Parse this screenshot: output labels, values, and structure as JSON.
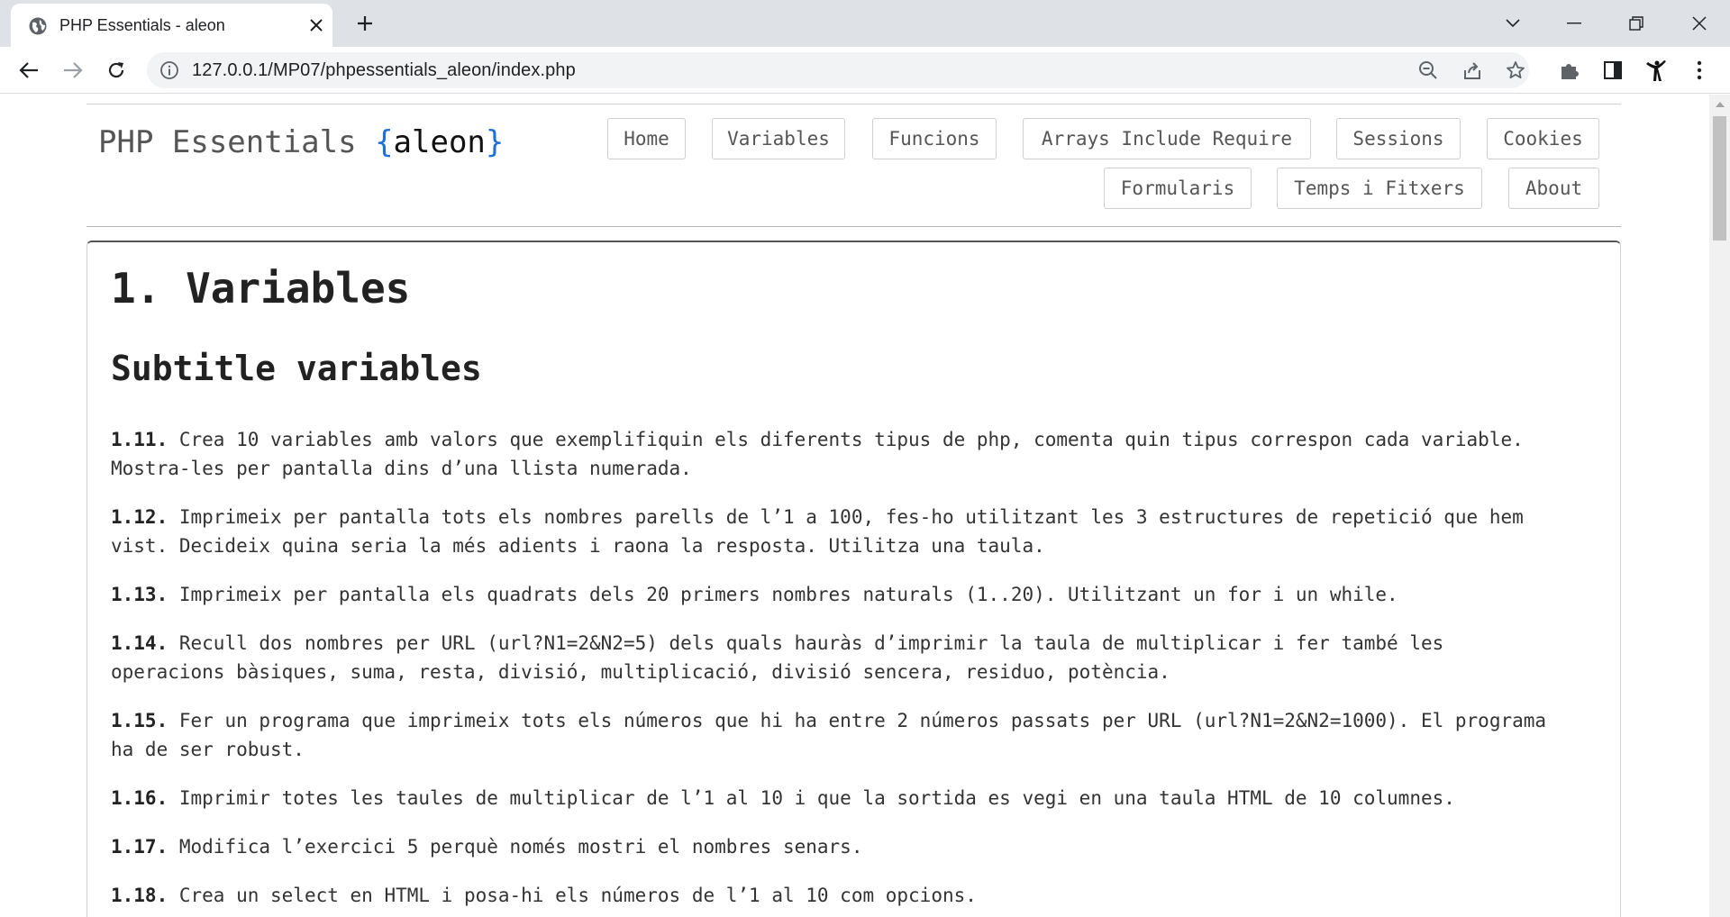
{
  "browser": {
    "tab_title": "PHP Essentials - aleon",
    "url": "127.0.0.1/MP07/phpessentials_aleon/index.php",
    "icons": [
      "globe-icon",
      "close-icon",
      "plus-icon",
      "chevron-down-icon",
      "minimize-icon",
      "restore-icon",
      "window-close-icon",
      "back-arrow-icon",
      "forward-arrow-icon",
      "reload-icon",
      "info-icon",
      "zoom-out-icon",
      "share-icon",
      "star-icon",
      "puzzle-icon",
      "side-panel-icon",
      "profile-icon",
      "kebab-menu-icon"
    ]
  },
  "site": {
    "brand_prefix": "PHP Essentials",
    "brace_open": "{",
    "brand_name": "aleon",
    "brace_close": "}",
    "nav": {
      "home": "Home",
      "variables": "Variables",
      "funcions": "Funcions",
      "arrays": "Arrays Include Require",
      "sessions": "Sessions",
      "cookies": "Cookies",
      "formularis": "Formularis",
      "temps": "Temps i Fitxers",
      "about": "About"
    }
  },
  "content": {
    "title": "1. Variables",
    "subtitle": "Subtitle variables",
    "exercises": [
      {
        "num": "1.11.",
        "text": "Crea 10 variables amb valors que exemplifiquin els diferents tipus de php, comenta quin tipus correspon cada variable.",
        "text2": "Mostra-les per pantalla dins d’una llista numerada."
      },
      {
        "num": "1.12.",
        "text": "Imprimeix per pantalla tots els nombres parells de l’1 a 100, fes-ho utilitzant les 3 estructures de repetició que hem",
        "text2": "vist. Decideix quina seria la més adients i raona la resposta. Utilitza una taula."
      },
      {
        "num": "1.13.",
        "text": "Imprimeix per pantalla els quadrats dels 20 primers nombres naturals (1..20). Utilitzant un for i un while.",
        "text2": ""
      },
      {
        "num": "1.14.",
        "text": "Recull dos nombres per URL (url?N1=2&N2=5) dels quals hauràs d’imprimir la taula de multiplicar i fer també les",
        "text2": "operacions bàsiques, suma, resta, divisió, multiplicació, divisió sencera, residuo, potència."
      },
      {
        "num": "1.15.",
        "text": "Fer un programa que imprimeix tots els números que hi ha entre 2 números passats per URL (url?N1=2&N2=1000). El programa",
        "text2": "ha de ser robust."
      },
      {
        "num": "1.16.",
        "text": "Imprimir totes les taules de multiplicar de l’1 al 10 i que la sortida es vegi en una taula HTML de 10 columnes.",
        "text2": ""
      },
      {
        "num": "1.17.",
        "text": "Modifica l’exercici 5 perquè només mostri el nombres senars.",
        "text2": ""
      },
      {
        "num": "1.18.",
        "text": "Crea un select en HTML i posa-hi els números de l’1 al 10 com opcions.",
        "text2": ""
      }
    ]
  }
}
